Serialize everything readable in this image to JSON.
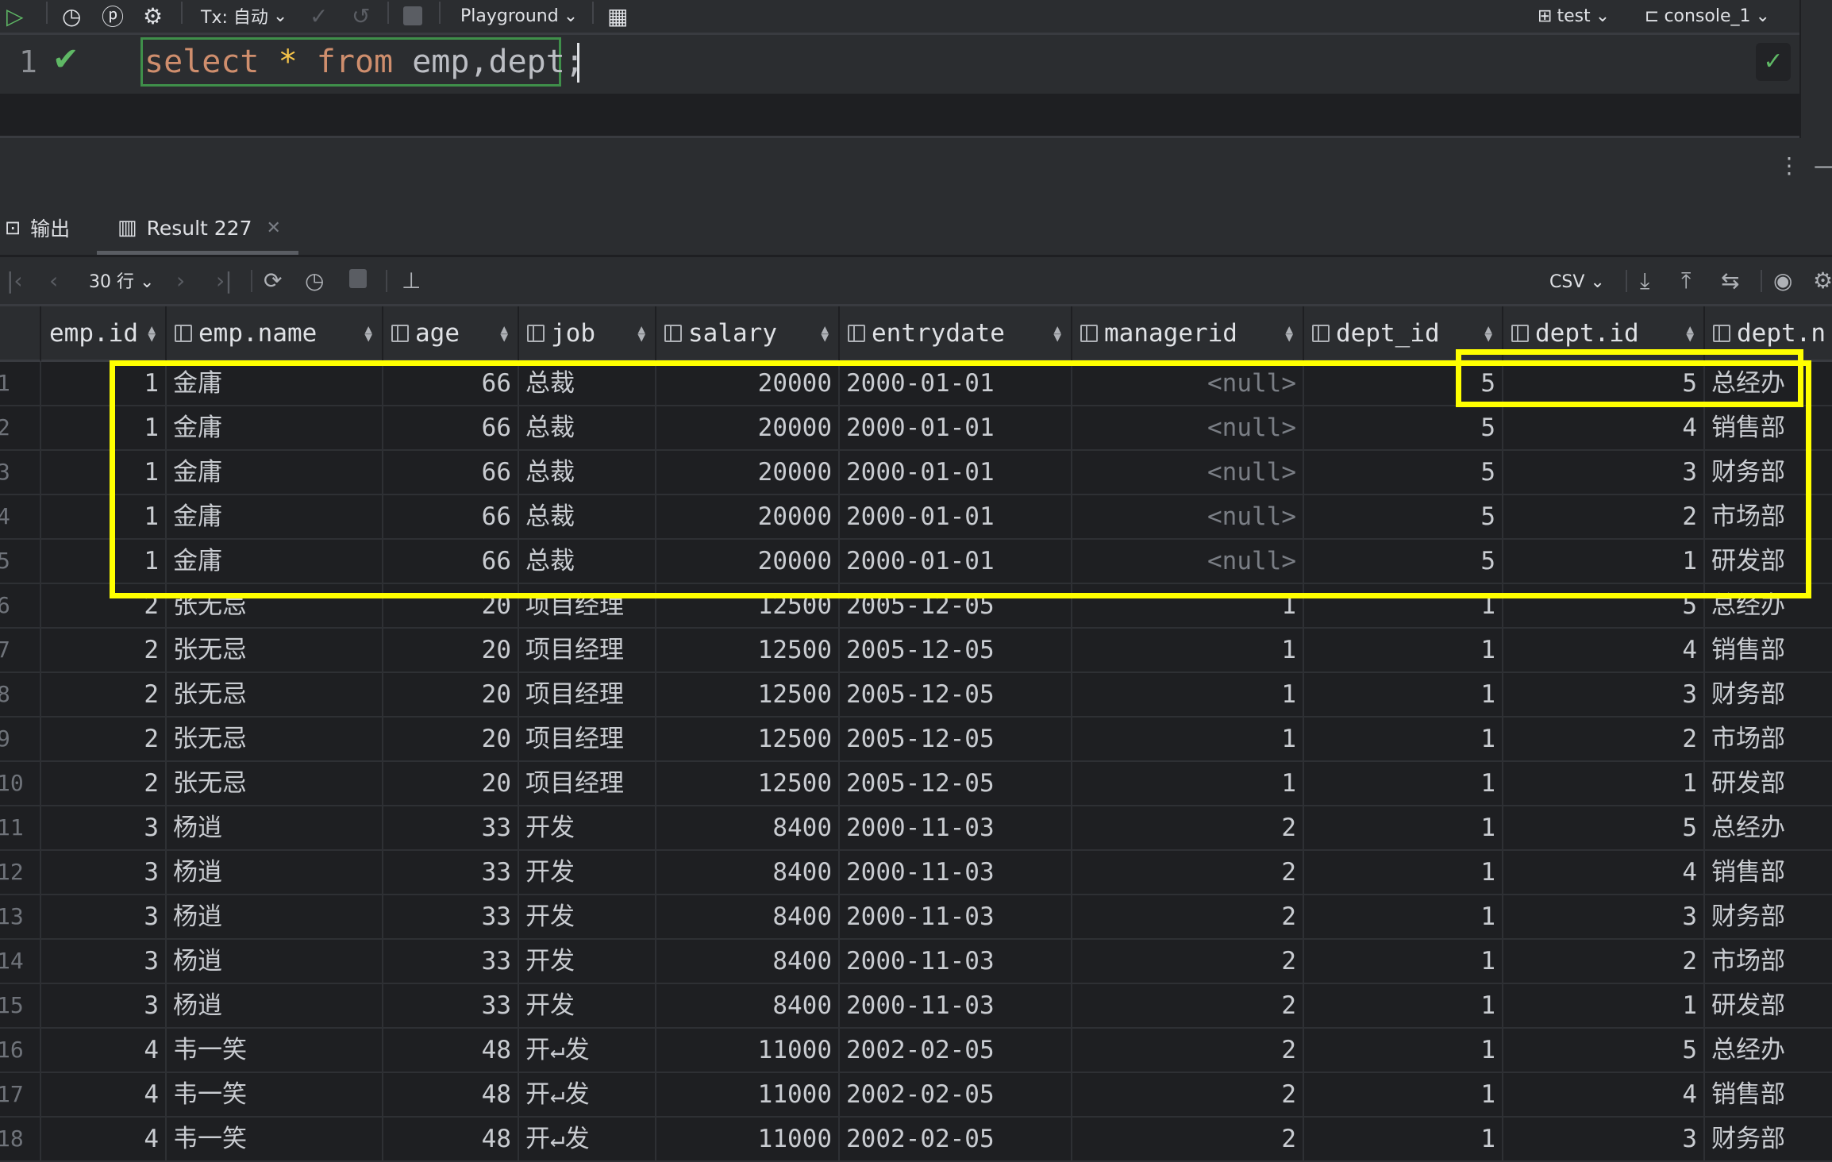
{
  "toolbar": {
    "tx_label": "Tx: 自动",
    "playground_label": "Playground",
    "schema_label": "test",
    "console_label": "console_1"
  },
  "editor": {
    "line_number": "1",
    "code_tokens": [
      {
        "t": "select",
        "c": "kw"
      },
      {
        "t": " ",
        "c": "id"
      },
      {
        "t": "*",
        "c": "star"
      },
      {
        "t": " ",
        "c": "id"
      },
      {
        "t": "from",
        "c": "kw"
      },
      {
        "t": " emp,dept",
        "c": "id"
      },
      {
        "t": ";",
        "c": "id"
      }
    ]
  },
  "tabs": {
    "output_label": "输出",
    "result_label": "Result 227"
  },
  "result_toolbar": {
    "page_size_label": "30 行",
    "export_format": "CSV"
  },
  "colors": {
    "highlight": "#ffff00",
    "success": "#5fb865"
  },
  "table": {
    "columns": [
      "emp.id",
      "emp.name",
      "age",
      "job",
      "salary",
      "entrydate",
      "managerid",
      "dept_id",
      "dept.id",
      "dept.n"
    ],
    "rows": [
      [
        "1",
        "金庸",
        "66",
        "总裁",
        "20000",
        "2000-01-01",
        "<null>",
        "5",
        "5",
        "总经办"
      ],
      [
        "1",
        "金庸",
        "66",
        "总裁",
        "20000",
        "2000-01-01",
        "<null>",
        "5",
        "4",
        "销售部"
      ],
      [
        "1",
        "金庸",
        "66",
        "总裁",
        "20000",
        "2000-01-01",
        "<null>",
        "5",
        "3",
        "财务部"
      ],
      [
        "1",
        "金庸",
        "66",
        "总裁",
        "20000",
        "2000-01-01",
        "<null>",
        "5",
        "2",
        "市场部"
      ],
      [
        "1",
        "金庸",
        "66",
        "总裁",
        "20000",
        "2000-01-01",
        "<null>",
        "5",
        "1",
        "研发部"
      ],
      [
        "2",
        "张无忌",
        "20",
        "项目经理",
        "12500",
        "2005-12-05",
        "1",
        "1",
        "5",
        "总经办"
      ],
      [
        "2",
        "张无忌",
        "20",
        "项目经理",
        "12500",
        "2005-12-05",
        "1",
        "1",
        "4",
        "销售部"
      ],
      [
        "2",
        "张无忌",
        "20",
        "项目经理",
        "12500",
        "2005-12-05",
        "1",
        "1",
        "3",
        "财务部"
      ],
      [
        "2",
        "张无忌",
        "20",
        "项目经理",
        "12500",
        "2005-12-05",
        "1",
        "1",
        "2",
        "市场部"
      ],
      [
        "2",
        "张无忌",
        "20",
        "项目经理",
        "12500",
        "2005-12-05",
        "1",
        "1",
        "1",
        "研发部"
      ],
      [
        "3",
        "杨逍",
        "33",
        "开发",
        "8400",
        "2000-11-03",
        "2",
        "1",
        "5",
        "总经办"
      ],
      [
        "3",
        "杨逍",
        "33",
        "开发",
        "8400",
        "2000-11-03",
        "2",
        "1",
        "4",
        "销售部"
      ],
      [
        "3",
        "杨逍",
        "33",
        "开发",
        "8400",
        "2000-11-03",
        "2",
        "1",
        "3",
        "财务部"
      ],
      [
        "3",
        "杨逍",
        "33",
        "开发",
        "8400",
        "2000-11-03",
        "2",
        "1",
        "2",
        "市场部"
      ],
      [
        "3",
        "杨逍",
        "33",
        "开发",
        "8400",
        "2000-11-03",
        "2",
        "1",
        "1",
        "研发部"
      ],
      [
        "4",
        "韦一笑",
        "48",
        "开↵发",
        "11000",
        "2002-02-05",
        "2",
        "1",
        "5",
        "总经办"
      ],
      [
        "4",
        "韦一笑",
        "48",
        "开↵发",
        "11000",
        "2002-02-05",
        "2",
        "1",
        "4",
        "销售部"
      ],
      [
        "4",
        "韦一笑",
        "48",
        "开↵发",
        "11000",
        "2002-02-05",
        "2",
        "1",
        "3",
        "财务部"
      ]
    ]
  }
}
